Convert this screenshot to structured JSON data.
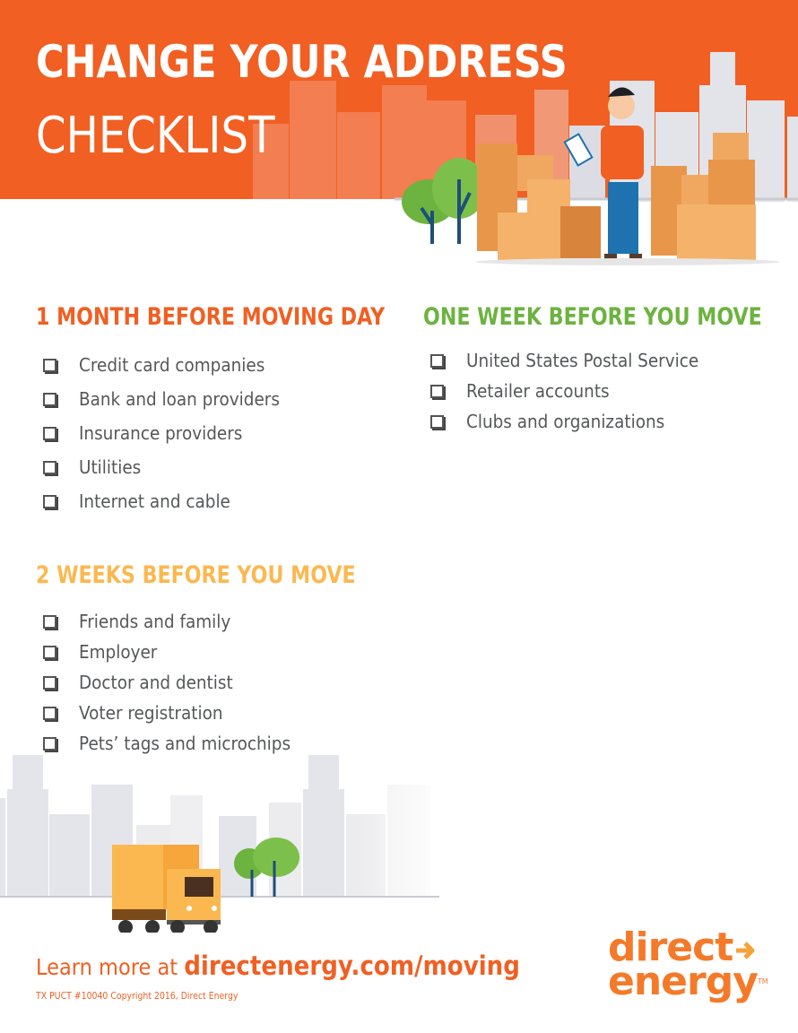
{
  "title": {
    "line1": "CHANGE YOUR ADDRESS",
    "line2": "CHECKLIST"
  },
  "colors": {
    "brand_orange": "#f15f22",
    "green": "#6cb33f",
    "yellow": "#fbb850",
    "body_text": "#555759"
  },
  "sections": [
    {
      "heading": "1 MONTH BEFORE MOVING DAY",
      "items": [
        "Credit card companies",
        "Bank and loan providers",
        "Insurance providers",
        "Utilities",
        "Internet and cable"
      ]
    },
    {
      "heading": "ONE WEEK BEFORE YOU MOVE",
      "items": [
        "United States Postal Service",
        "Retailer accounts",
        "Clubs and organizations"
      ]
    },
    {
      "heading": "2 WEEKS BEFORE YOU MOVE",
      "items": [
        "Friends and family",
        "Employer",
        "Doctor and dentist",
        "Voter registration",
        "Pets’ tags and microchips"
      ]
    }
  ],
  "illustrations": {
    "top": "man-with-clipboard-boxes-city",
    "bottom": "moving-truck-trees-city"
  },
  "footer": {
    "learn_prefix": "Learn more at ",
    "url": "directenergy.com/moving",
    "copyright": "TX PUCT #10040 Copyright 2016, Direct Energy"
  },
  "logo": {
    "line1": "direct",
    "line2": "energy",
    "tm": "TM"
  }
}
